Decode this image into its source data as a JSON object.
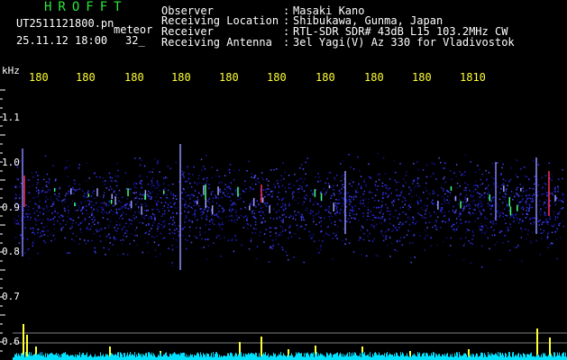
{
  "header": {
    "logo": "HROFFT",
    "filename": "UT2511121800.pn",
    "stream": "meteor",
    "datetime": "25.11.12 18:00",
    "count": "32_"
  },
  "info": [
    {
      "label": "Observer",
      "value": "Masaki Kano"
    },
    {
      "label": "Receiving Location",
      "value": "Shibukawa, Gunma, Japan"
    },
    {
      "label": "Receiver",
      "value": "RTL-SDR SDR# 43dB L15 103.2MHz CW"
    },
    {
      "label": "Receiving Antenna",
      "value": "3el Yagi(V) Az 330 for Vladivostok"
    }
  ],
  "axis": {
    "unit": "kHz",
    "time_ticks": [
      "180",
      "180",
      "180",
      "180",
      "180",
      "180",
      "180",
      "180",
      "180",
      "1810"
    ],
    "freq_ticks": [
      "1.1",
      "1.0",
      "0.9",
      "0.8",
      "0.7",
      "0.6"
    ]
  },
  "colors": {
    "background": "#000000",
    "header_text": "#28e83a",
    "label_text": "#ffffff",
    "tick_text": "#ffff33",
    "noise": "#1a1aa0",
    "meteor": "#ff3060",
    "echo_bar": "#ffff33",
    "floor": "#00e0ff"
  }
}
